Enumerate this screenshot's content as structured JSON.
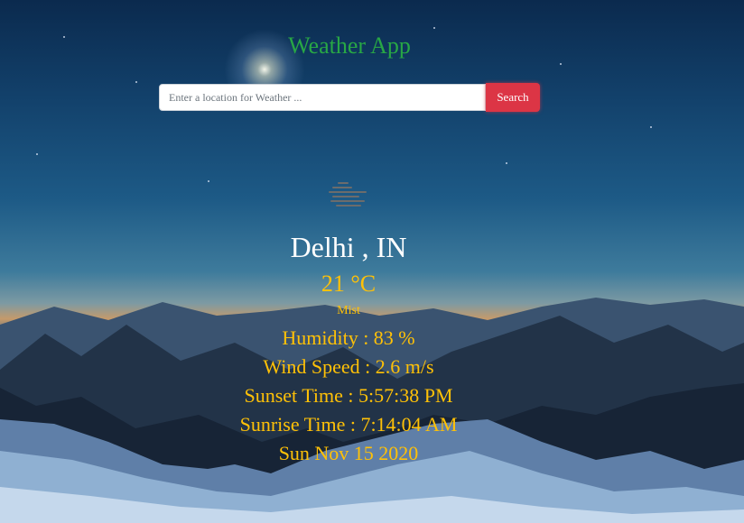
{
  "app": {
    "title": "Weather App"
  },
  "search": {
    "placeholder": "Enter a location for Weather ...",
    "value": "",
    "button_label": "Search"
  },
  "weather": {
    "icon": "mist-icon",
    "location": "Delhi , IN",
    "temperature": "21 °C",
    "description": "Mist",
    "humidity": "Humidity : 83 %",
    "wind_speed": "Wind Speed : 2.6 m/s",
    "sunset": "Sunset Time : 5:57:38 PM",
    "sunrise": "Sunrise Time : 7:14:04 AM",
    "date": "Sun Nov 15 2020"
  },
  "colors": {
    "title": "#28a745",
    "accent": "#ffc107",
    "button": "#dc3545",
    "city": "#ffffff"
  }
}
